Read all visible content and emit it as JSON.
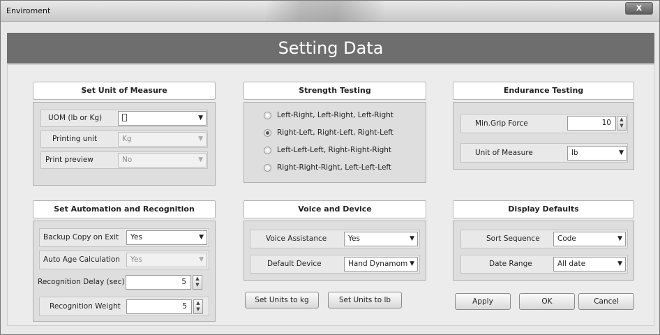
{
  "window": {
    "title": "Enviroment",
    "close_glyph": "x"
  },
  "header": {
    "title": "Setting Data"
  },
  "unit_of_measure": {
    "title": "Set Unit of Measure",
    "uom_label": "UOM (lb or Kg)",
    "uom_value": "",
    "printing_unit_label": "Printing unit",
    "printing_unit_value": "Kg",
    "print_preview_label": "Print preview",
    "print_preview_value": "No"
  },
  "strength": {
    "title": "Strength Testing",
    "options": [
      "Left-Right, Left-Right, Left-Right",
      "Right-Left, Right-Left, Right-Left",
      "Left-Left-Left, Right-Right-Right",
      "Right-Right-Right, Left-Left-Left"
    ],
    "selected_index": 1
  },
  "endurance": {
    "title": "Endurance Testing",
    "min_grip_label": "Min.Grip Force",
    "min_grip_value": "10",
    "unit_label": "Unit of Measure",
    "unit_value": "lb"
  },
  "automation": {
    "title": "Set Automation and Recognition",
    "backup_label": "Backup Copy on Exit",
    "backup_value": "Yes",
    "auto_age_label": "Auto Age Calculation",
    "auto_age_value": "Yes",
    "delay_label": "Recognition Delay (sec)",
    "delay_value": "5",
    "weight_label": "Recognition Weight",
    "weight_value": "5"
  },
  "voice": {
    "title": "Voice and Device",
    "assist_label": "Voice Assistance",
    "assist_value": "Yes",
    "device_label": "Default Device",
    "device_value": "Hand Dynamom"
  },
  "display": {
    "title": "Display Defaults",
    "sort_label": "Sort Sequence",
    "sort_value": "Code",
    "date_label": "Date Range",
    "date_value": "All date"
  },
  "buttons": {
    "set_kg": "Set Units to kg",
    "set_lb": "Set Units to lb",
    "apply": "Apply",
    "ok": "OK",
    "cancel": "Cancel"
  },
  "glyphs": {
    "dropdown": "▼",
    "spin_up": "▲",
    "spin_down": "▼"
  }
}
